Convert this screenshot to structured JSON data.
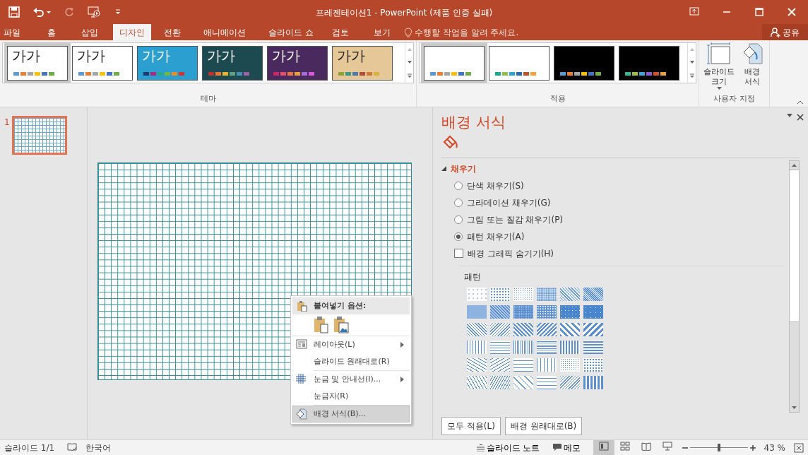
{
  "title_bar": {
    "title": "프레젠테이션1 - PowerPoint (제품 인증 실패)"
  },
  "tabs": [
    {
      "label": "파일",
      "selected": false
    },
    {
      "label": "홈",
      "selected": false
    },
    {
      "label": "삽입",
      "selected": false
    },
    {
      "label": "디자인",
      "selected": true
    },
    {
      "label": "전환",
      "selected": false
    },
    {
      "label": "애니메이션",
      "selected": false
    },
    {
      "label": "슬라이드 쇼",
      "selected": false
    },
    {
      "label": "검토",
      "selected": false
    },
    {
      "label": "보기",
      "selected": false
    }
  ],
  "tell_me": {
    "placeholder": "수행할 작업을 알려 주세요."
  },
  "share": "공유",
  "themes": {
    "label": "테마",
    "items": [
      {
        "text": "가가",
        "selected": true,
        "color": "#ffffff",
        "swatches": [
          {
            "color": "#5b9bd5"
          },
          {
            "color": "#ed7d31"
          },
          {
            "color": "#a5a5a5"
          },
          {
            "color": "#ffc000"
          },
          {
            "color": "#4472c4"
          },
          {
            "color": "#70ad47"
          }
        ]
      },
      {
        "text": "가가",
        "selected": false,
        "color": "#ffffff",
        "swatches": [
          {
            "color": "#5b9bd5"
          },
          {
            "color": "#ed7d31"
          },
          {
            "color": "#a5a5a5"
          },
          {
            "color": "#ffc000"
          },
          {
            "color": "#4472c4"
          },
          {
            "color": "#70ad47"
          }
        ]
      },
      {
        "text": "가가",
        "selected": false,
        "color": "#2a9fd0",
        "swatches": [
          {
            "color": "#1f3b70"
          },
          {
            "color": "#b3257a"
          },
          {
            "color": "#2aa58e"
          },
          {
            "color": "#73b442"
          },
          {
            "color": "#ef8a2a"
          },
          {
            "color": "#d6322f"
          }
        ]
      },
      {
        "text": "가가",
        "selected": false,
        "color": "#1c4a50",
        "swatches": [
          {
            "color": "#c0302c"
          },
          {
            "color": "#e8762b"
          },
          {
            "color": "#e8b52b"
          },
          {
            "color": "#63a27e"
          },
          {
            "color": "#4c8cb0"
          },
          {
            "color": "#9b63a8"
          }
        ]
      },
      {
        "text": "가가",
        "selected": false,
        "color": "#4a2a5e",
        "swatches": [
          {
            "color": "#c8276c"
          },
          {
            "color": "#e84c6b"
          },
          {
            "color": "#e8763b"
          },
          {
            "color": "#e8a03b"
          },
          {
            "color": "#a86cd6"
          },
          {
            "color": "#d65ad6"
          }
        ]
      },
      {
        "text": "가가",
        "selected": false,
        "color": "#e6c898",
        "swatches": [
          {
            "color": "#8aa63a"
          },
          {
            "color": "#3a9a8a"
          },
          {
            "color": "#4a7ab0"
          },
          {
            "color": "#b04a3a"
          },
          {
            "color": "#d07a3a"
          },
          {
            "color": "#d8b03a"
          }
        ]
      }
    ]
  },
  "variants": {
    "label": "적용",
    "items": [
      {
        "selected": true,
        "color": "#ffffff",
        "swatches": [
          {
            "color": "#5b9bd5"
          },
          {
            "color": "#ed7d31"
          },
          {
            "color": "#a5a5a5"
          },
          {
            "color": "#ffc000"
          },
          {
            "color": "#4472c4"
          },
          {
            "color": "#70ad47"
          }
        ]
      },
      {
        "selected": false,
        "color": "#ffffff",
        "swatches": [
          {
            "color": "#1ca68a"
          },
          {
            "color": "#8dc04c"
          },
          {
            "color": "#2da5d3"
          },
          {
            "color": "#2b6cb0"
          },
          {
            "color": "#c0502c"
          },
          {
            "color": "#f4a23a"
          }
        ]
      },
      {
        "selected": false,
        "color": "#000000",
        "swatches": [
          {
            "color": "#5b9bd5"
          },
          {
            "color": "#ed7d31"
          },
          {
            "color": "#a5a5a5"
          },
          {
            "color": "#ffc000"
          },
          {
            "color": "#4472c4"
          },
          {
            "color": "#70ad47"
          }
        ]
      },
      {
        "selected": false,
        "color": "#000000",
        "swatches": [
          {
            "color": "#3ab88a"
          },
          {
            "color": "#9ac04c"
          },
          {
            "color": "#3aa5d3"
          },
          {
            "color": "#8a5ad0"
          },
          {
            "color": "#d0502c"
          },
          {
            "color": "#e8a03a"
          }
        ]
      }
    ]
  },
  "customize": {
    "label": "사용자 지정",
    "buttons": [
      {
        "kind": "size",
        "label": "슬라이드 크기",
        "dropdown": true
      },
      {
        "kind": "background",
        "label": "배경 서식",
        "dropdown": false
      }
    ]
  },
  "slides": [
    {
      "number": "1",
      "selected": true
    }
  ],
  "context_menu": {
    "header": "붙여넣기 옵션:",
    "items": [
      {
        "kind": "paste"
      },
      {
        "kind": "layout",
        "label": "레이아웃(L)",
        "submenu": true,
        "selected": false
      },
      {
        "kind": "plain",
        "label": "슬라이드 원래대로(R)",
        "submenu": false,
        "selected": false
      },
      {
        "kind": "grid",
        "label": "눈금 및 안내선(I)...",
        "submenu": true,
        "selected": false
      },
      {
        "kind": "plain",
        "label": "눈금자(R)",
        "submenu": false,
        "selected": false
      },
      {
        "kind": "background",
        "label": "배경 서식(B)...",
        "submenu": false,
        "selected": true
      }
    ]
  },
  "format_pane": {
    "title": "배경 서식",
    "section": {
      "label": "채우기",
      "expanded": true
    },
    "options": [
      {
        "label": "단색 채우기(S)",
        "selected": false
      },
      {
        "label": "그라데이션 채우기(G)",
        "selected": false
      },
      {
        "label": "그림 또는 질감 채우기(P)",
        "selected": false
      },
      {
        "label": "패턴 채우기(A)",
        "selected": true
      }
    ],
    "hide_graphics": {
      "label": "배경 그래픽 숨기기(H)",
      "checked": false
    },
    "pattern_label": "패턴",
    "buttons": [
      "모두 적용(L)",
      "배경 원래대로(B)"
    ]
  },
  "status_bar": {
    "slide": "슬라이드 1/1",
    "language": "한국어",
    "notes": "슬라이드 노트",
    "comments": "메모",
    "zoom": "43 %",
    "zoom_level": {
      "level": 0.5
    }
  }
}
